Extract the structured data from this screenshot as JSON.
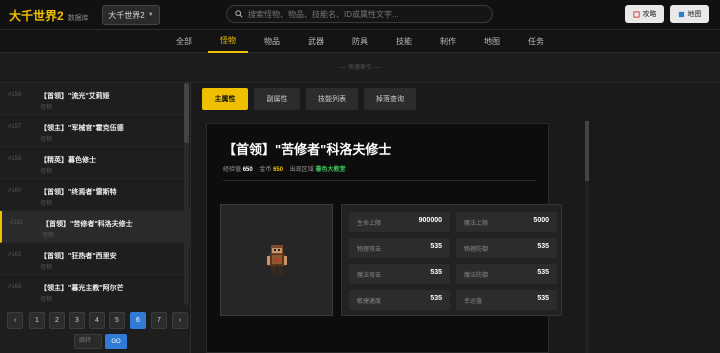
{
  "header": {
    "logo": "大千世界2",
    "logo_sub": "数据库",
    "version": "大千世界2",
    "search_placeholder": "搜索怪物、物品、技能名、ID或属性文字...",
    "guide_label": "攻略",
    "map_label": "地图"
  },
  "nav": {
    "tabs": [
      "全部",
      "怪物",
      "物品",
      "武器",
      "防具",
      "技能",
      "制作",
      "地图",
      "任务"
    ],
    "active": 1
  },
  "quick_index": "— 快速索引 —",
  "list": {
    "items": [
      {
        "num": "#156",
        "name": "【首领】\"流光\"艾莉娅",
        "sub": "怪物"
      },
      {
        "num": "#157",
        "name": "【领主】\"军械官\"霍克伍德",
        "sub": "怪物"
      },
      {
        "num": "#158",
        "name": "【精英】暮色修士",
        "sub": "怪物"
      },
      {
        "num": "#160",
        "name": "【首领】\"终焉者\"雷斯特",
        "sub": "怪物"
      },
      {
        "num": "#161",
        "name": "【首领】\"苦修者\"科洛夫修士",
        "sub": "怪物"
      },
      {
        "num": "#162",
        "name": "【首领】\"狂热者\"西里安",
        "sub": "怪物"
      },
      {
        "num": "#165",
        "name": "【领主】\"暮光主教\"阿尔芒",
        "sub": "怪物"
      }
    ],
    "active_index": 4
  },
  "pager": {
    "prev": "‹",
    "next": "›",
    "pages": [
      "1",
      "2",
      "3",
      "4",
      "5",
      "6",
      "7"
    ],
    "active_page": "6",
    "jump_placeholder": "跳转",
    "go_label": "GO"
  },
  "subtabs": [
    "主属性",
    "副属性",
    "技能列表",
    "掉落查询"
  ],
  "detail": {
    "title": "【首领】\"苦修者\"科洛夫修士",
    "exp_label": "经验值",
    "exp_value": "650",
    "gold_label": "金币",
    "gold_value": "650",
    "area_label": "出现区域",
    "area_value": "暮色大教堂",
    "stats": [
      {
        "label": "生命上限",
        "value": "900000"
      },
      {
        "label": "魔法上限",
        "value": "5000"
      },
      {
        "label": "物理攻击",
        "value": "535"
      },
      {
        "label": "物理防御",
        "value": "535"
      },
      {
        "label": "魔法攻击",
        "value": "535"
      },
      {
        "label": "魔法防御",
        "value": "535"
      },
      {
        "label": "敏捷速度",
        "value": "535"
      },
      {
        "label": "幸运值",
        "value": "535"
      }
    ]
  },
  "colors": {
    "accent": "#f0c000",
    "link_blue": "#2f7bd6",
    "area_green": "#3fc35a"
  }
}
